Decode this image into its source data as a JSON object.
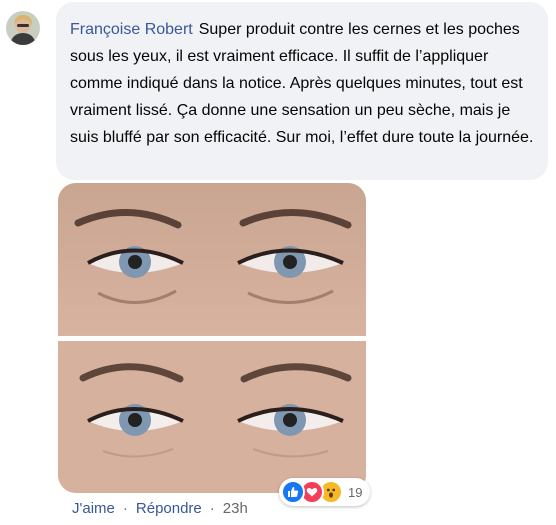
{
  "comment": {
    "author": "Françoise Robert",
    "text": "Super produit contre les cernes et les poches sous les yeux, il est vraiment efficace. Il suffit de l’appliquer comme indiqué dans la notice. Après quelques minutes, tout est vraiment lissé. Ça donne une sensation un peu sèche, mais je suis bluffé par son efficacité. Sur moi, l’effet dure toute la journée."
  },
  "reactions": {
    "icons": [
      "like-icon",
      "love-icon",
      "wow-icon"
    ],
    "count": "19"
  },
  "actions": {
    "like_label": "J'aime",
    "reply_label": "Répondre",
    "separator": "·",
    "timestamp": "23h"
  },
  "colors": {
    "author": "#385898",
    "bubble_bg": "#f0f2f5",
    "meta": "#65676b",
    "like": "#1877f2",
    "love": "#f33e58",
    "wow": "#f7b928"
  }
}
